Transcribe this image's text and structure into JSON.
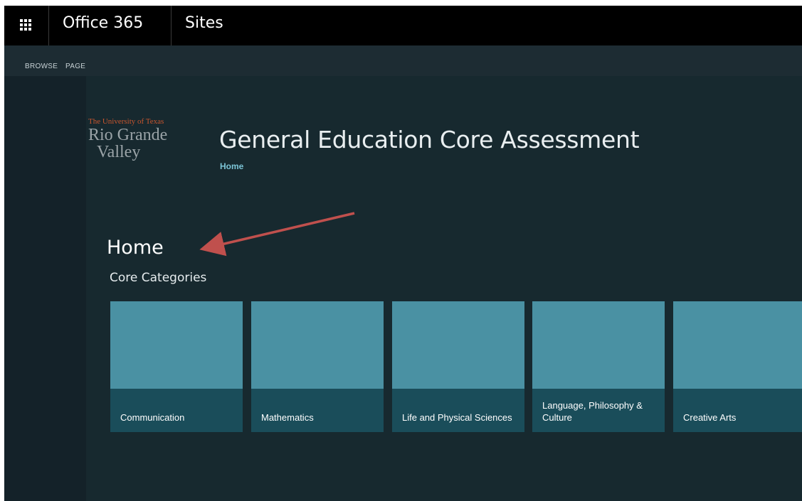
{
  "suitebar": {
    "brand": "Office 365",
    "app": "Sites"
  },
  "ribbon": {
    "tabs": [
      "BROWSE",
      "PAGE"
    ]
  },
  "logo": {
    "line1": "The University of Texas",
    "line2": "Rio Grande",
    "line3": "Valley"
  },
  "site": {
    "title": "General Education Core Assessment",
    "breadcrumb": "Home"
  },
  "page": {
    "title": "Home",
    "section": "Core Categories"
  },
  "tiles": [
    {
      "label": "Communication"
    },
    {
      "label": "Mathematics"
    },
    {
      "label": "Life and Physical Sciences"
    },
    {
      "label": "Language, Philosophy & Culture"
    },
    {
      "label": "Creative Arts"
    }
  ],
  "colors": {
    "tile": "#4a91a3",
    "tile_label_bar": "#1a4d5a",
    "background": "#17292f",
    "arrow": "#c0504d",
    "logo_accent": "#c8552e"
  }
}
